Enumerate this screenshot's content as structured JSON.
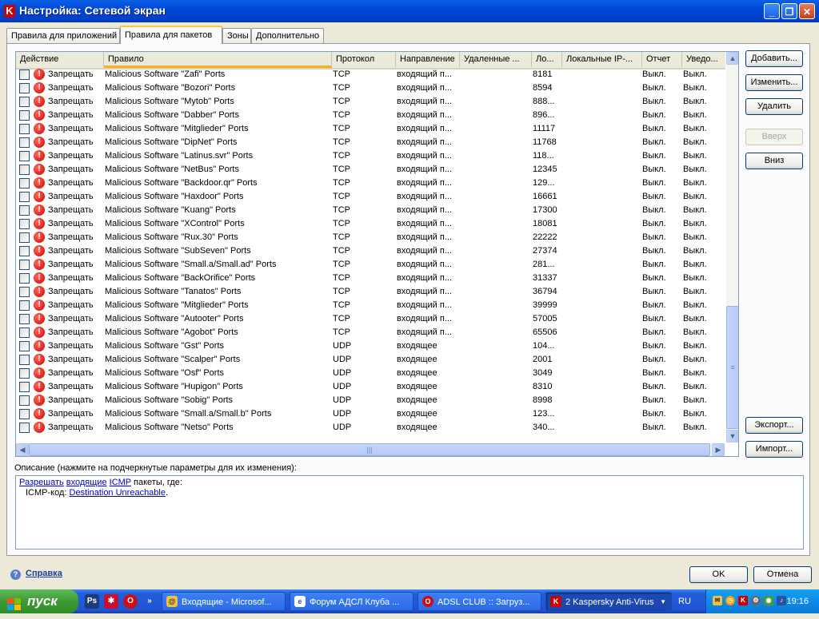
{
  "window": {
    "title": "Настройка: Сетевой экран",
    "app_icon_letter": "K"
  },
  "tabs": [
    {
      "label": "Правила для приложений",
      "active": false
    },
    {
      "label": "Правила для пакетов",
      "active": true
    },
    {
      "label": "Зоны",
      "active": false
    },
    {
      "label": "Дополнительно",
      "active": false
    }
  ],
  "columns": [
    "Действие",
    "Правило",
    "Протокол",
    "Направление",
    "Удаленные ...",
    "Ло...",
    "Локальные IP-...",
    "Отчет",
    "Уведо..."
  ],
  "rows": [
    [
      "Запрещать",
      "Malicious Software \"Zafi\" Ports",
      "TCP",
      "входящий п...",
      "8181",
      "Выкл.",
      "Выкл."
    ],
    [
      "Запрещать",
      "Malicious Software \"Bozori\" Ports",
      "TCP",
      "входящий п...",
      "8594",
      "Выкл.",
      "Выкл."
    ],
    [
      "Запрещать",
      "Malicious Software \"Mytob\" Ports",
      "TCP",
      "входящий п...",
      "888...",
      "Выкл.",
      "Выкл."
    ],
    [
      "Запрещать",
      "Malicious Software \"Dabber\" Ports",
      "TCP",
      "входящий п...",
      "896...",
      "Выкл.",
      "Выкл."
    ],
    [
      "Запрещать",
      "Malicious Software \"Mitglieder\" Ports",
      "TCP",
      "входящий п...",
      "11117",
      "Выкл.",
      "Выкл."
    ],
    [
      "Запрещать",
      "Malicious Software \"DipNet\" Ports",
      "TCP",
      "входящий п...",
      "11768",
      "Выкл.",
      "Выкл."
    ],
    [
      "Запрещать",
      "Malicious Software \"Latinus.svr\" Ports",
      "TCP",
      "входящий п...",
      "118...",
      "Выкл.",
      "Выкл."
    ],
    [
      "Запрещать",
      "Malicious Software \"NetBus\" Ports",
      "TCP",
      "входящий п...",
      "12345",
      "Выкл.",
      "Выкл."
    ],
    [
      "Запрещать",
      "Malicious Software \"Backdoor.qr\" Ports",
      "TCP",
      "входящий п...",
      "129...",
      "Выкл.",
      "Выкл."
    ],
    [
      "Запрещать",
      "Malicious Software \"Haxdoor\" Ports",
      "TCP",
      "входящий п...",
      "16661",
      "Выкл.",
      "Выкл."
    ],
    [
      "Запрещать",
      "Malicious Software \"Kuang\" Ports",
      "TCP",
      "входящий п...",
      "17300",
      "Выкл.",
      "Выкл."
    ],
    [
      "Запрещать",
      "Malicious Software \"XControl\" Ports",
      "TCP",
      "входящий п...",
      "18081",
      "Выкл.",
      "Выкл."
    ],
    [
      "Запрещать",
      "Malicious Software \"Rux.30\" Ports",
      "TCP",
      "входящий п...",
      "22222",
      "Выкл.",
      "Выкл."
    ],
    [
      "Запрещать",
      "Malicious Software \"SubSeven\" Ports",
      "TCP",
      "входящий п...",
      "27374",
      "Выкл.",
      "Выкл."
    ],
    [
      "Запрещать",
      "Malicious Software \"Small.a/Small.ad\" Ports",
      "TCP",
      "входящий п...",
      "281...",
      "Выкл.",
      "Выкл."
    ],
    [
      "Запрещать",
      "Malicious Software \"BackOrifice\" Ports",
      "TCP",
      "входящий п...",
      "31337",
      "Выкл.",
      "Выкл."
    ],
    [
      "Запрещать",
      "Malicious Software \"Tanatos\" Ports",
      "TCP",
      "входящий п...",
      "36794",
      "Выкл.",
      "Выкл."
    ],
    [
      "Запрещать",
      "Malicious Software \"Mitglieder\" Ports",
      "TCP",
      "входящий п...",
      "39999",
      "Выкл.",
      "Выкл."
    ],
    [
      "Запрещать",
      "Malicious Software \"Autooter\" Ports",
      "TCP",
      "входящий п...",
      "57005",
      "Выкл.",
      "Выкл."
    ],
    [
      "Запрещать",
      "Malicious Software \"Agobot\" Ports",
      "TCP",
      "входящий п...",
      "65506",
      "Выкл.",
      "Выкл."
    ],
    [
      "Запрещать",
      "Malicious Software \"Gst\" Ports",
      "UDP",
      "входящее",
      "104...",
      "Выкл.",
      "Выкл."
    ],
    [
      "Запрещать",
      "Malicious Software \"Scalper\" Ports",
      "UDP",
      "входящее",
      "2001",
      "Выкл.",
      "Выкл."
    ],
    [
      "Запрещать",
      "Malicious Software \"Osf\" Ports",
      "UDP",
      "входящее",
      "3049",
      "Выкл.",
      "Выкл."
    ],
    [
      "Запрещать",
      "Malicious Software \"Hupigon\" Ports",
      "UDP",
      "входящее",
      "8310",
      "Выкл.",
      "Выкл."
    ],
    [
      "Запрещать",
      "Malicious Software \"Sobig\" Ports",
      "UDP",
      "входящее",
      "8998",
      "Выкл.",
      "Выкл."
    ],
    [
      "Запрещать",
      "Malicious Software \"Small.a/Small.b\" Ports",
      "UDP",
      "входящее",
      "123...",
      "Выкл.",
      "Выкл."
    ],
    [
      "Запрещать",
      "Malicious Software \"Netso\" Ports",
      "UDP",
      "входящее",
      "340...",
      "Выкл.",
      "Выкл."
    ]
  ],
  "buttons": {
    "add": "Добавить...",
    "edit": "Изменить...",
    "delete": "Удалить",
    "up": "Вверх",
    "down": "Вниз",
    "export": "Экспорт...",
    "import": "Импорт...",
    "ok": "OK",
    "cancel": "Отмена"
  },
  "description": {
    "label": "Описание (нажмите на подчеркнутые параметры для их изменения):",
    "link_allow": "Разрешать",
    "link_incoming": "входящие",
    "link_icmp": "ICMP",
    "text_packets": "пакеты, где:",
    "icmp_code_label": "ICMP-код:",
    "link_destination": "Destination Unreachable",
    "period": "."
  },
  "help": {
    "label": "Справка"
  },
  "taskbar": {
    "start": "пуск",
    "buttons": [
      "Входящие - Microsof...",
      "Форум АДСЛ Клуба ...",
      "ADSL CLUB :: Загруз...",
      "2 Kaspersky Anti-Virus"
    ],
    "lang": "RU",
    "clock": "19:16",
    "ql_ps": "Ps",
    "ql_more": "»"
  }
}
